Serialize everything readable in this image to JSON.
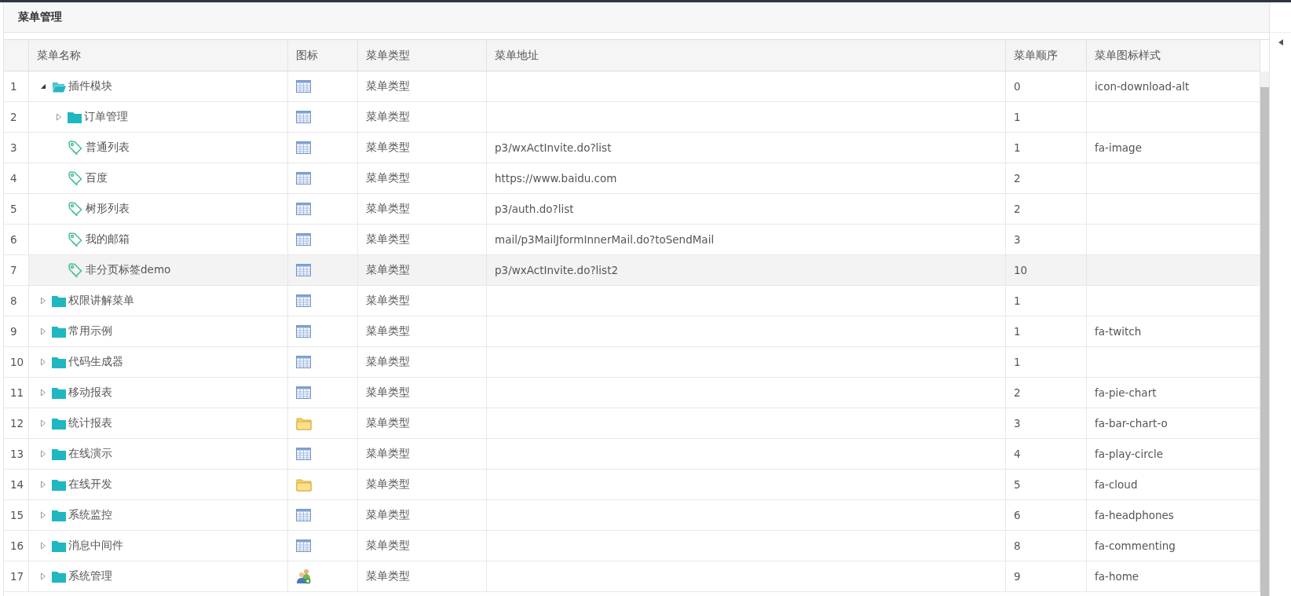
{
  "panel": {
    "title": "菜单管理"
  },
  "table": {
    "columns": [
      "菜单名称",
      "图标",
      "菜单类型",
      "菜单地址",
      "菜单顺序",
      "菜单图标样式"
    ],
    "rows": [
      {
        "number": "1",
        "name": "插件模块",
        "kind": "folder",
        "expanded": true,
        "type": "菜单类型",
        "order": "0",
        "style": "icon-download-alt",
        "selected": false,
        "children": [
          {
            "number": "2",
            "name": "订单管理",
            "kind": "folder",
            "expanded": false,
            "type": "菜单类型",
            "order": "1",
            "selected": false
          },
          {
            "number": "3",
            "name": "普通列表",
            "kind": "leaf",
            "type": "菜单类型",
            "url": "p3/wxActInvite.do?list",
            "order": "1",
            "style": "fa-image",
            "selected": false
          },
          {
            "number": "4",
            "name": "百度",
            "kind": "leaf",
            "type": "菜单类型",
            "url": "https://www.baidu.com",
            "order": "2",
            "selected": false
          },
          {
            "number": "5",
            "name": "树形列表",
            "kind": "leaf",
            "type": "菜单类型",
            "url": "p3/auth.do?list",
            "order": "2",
            "selected": false
          },
          {
            "number": "6",
            "name": "我的邮箱",
            "kind": "leaf",
            "type": "菜单类型",
            "url": "mail/p3MailJformInnerMail.do?toSendMail",
            "order": "3",
            "selected": false
          },
          {
            "number": "7",
            "name": "非分页标签demo",
            "kind": "leaf",
            "type": "菜单类型",
            "url": "p3/wxActInvite.do?list2",
            "order": "10",
            "selected": true
          }
        ]
      },
      {
        "number": "8",
        "name": "权限讲解菜单",
        "kind": "folder",
        "expanded": false,
        "type": "菜单类型",
        "order": "1",
        "selected": false
      },
      {
        "number": "9",
        "name": "常用示例",
        "kind": "folder",
        "expanded": false,
        "type": "菜单类型",
        "order": "1",
        "style": "fa-twitch",
        "selected": false
      },
      {
        "number": "10",
        "name": "代码生成器",
        "kind": "folder",
        "expanded": false,
        "type": "菜单类型",
        "order": "1",
        "selected": false
      },
      {
        "number": "11",
        "name": "移动报表",
        "kind": "folder",
        "expanded": false,
        "type": "菜单类型",
        "order": "2",
        "style": "fa-pie-chart",
        "selected": false
      },
      {
        "number": "12",
        "name": "统计报表",
        "kind": "folder",
        "expanded": false,
        "type": "菜单类型",
        "order": "3",
        "style": "fa-bar-chart-o",
        "selected": false
      },
      {
        "number": "13",
        "name": "在线演示",
        "kind": "folder",
        "expanded": false,
        "type": "菜单类型",
        "order": "4",
        "style": "fa-play-circle",
        "selected": false
      },
      {
        "number": "14",
        "name": "在线开发",
        "kind": "folder",
        "expanded": false,
        "type": "菜单类型",
        "order": "5",
        "style": "fa-cloud",
        "selected": false
      },
      {
        "number": "15",
        "name": "系统监控",
        "kind": "folder",
        "expanded": false,
        "type": "菜单类型",
        "order": "6",
        "style": "fa-headphones",
        "selected": false
      },
      {
        "number": "16",
        "name": "消息中间件",
        "kind": "folder",
        "expanded": false,
        "type": "菜单类型",
        "order": "8",
        "style": "fa-commenting",
        "selected": false
      },
      {
        "number": "17",
        "name": "系统管理",
        "kind": "folder",
        "expanded": false,
        "type": "菜单类型",
        "order": "9",
        "style": "fa-home",
        "selected": false
      }
    ]
  }
}
